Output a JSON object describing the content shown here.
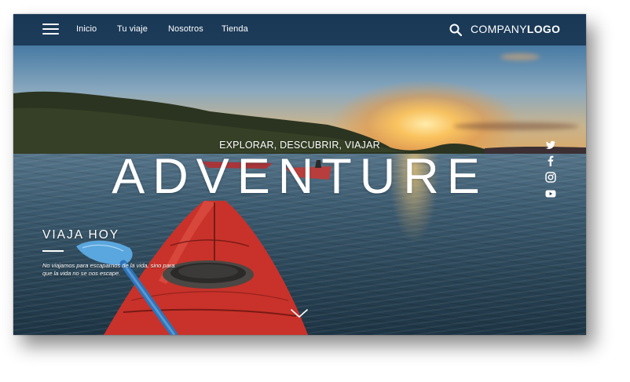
{
  "nav": {
    "links": [
      "Inicio",
      "Tu viaje",
      "Nosotros",
      "Tienda"
    ],
    "logo_regular": "COMPANY",
    "logo_bold": "LOGO"
  },
  "hero": {
    "tagline": "EXPLORAR, DESCUBRIR, VIAJAR",
    "title": "ADVENTURE"
  },
  "feature": {
    "title": "VIAJA HOY",
    "quote_line1": "No viajamos para escaparnos de la vida, sino para",
    "quote_line2": "que la vida no se nos escape."
  },
  "social": [
    "twitter-icon",
    "facebook-icon",
    "instagram-icon",
    "youtube-icon"
  ],
  "colors": {
    "nav_bg": "#16324e",
    "text": "#ffffff",
    "kayak": "#c8322a",
    "paddle": "#5aa6de"
  }
}
